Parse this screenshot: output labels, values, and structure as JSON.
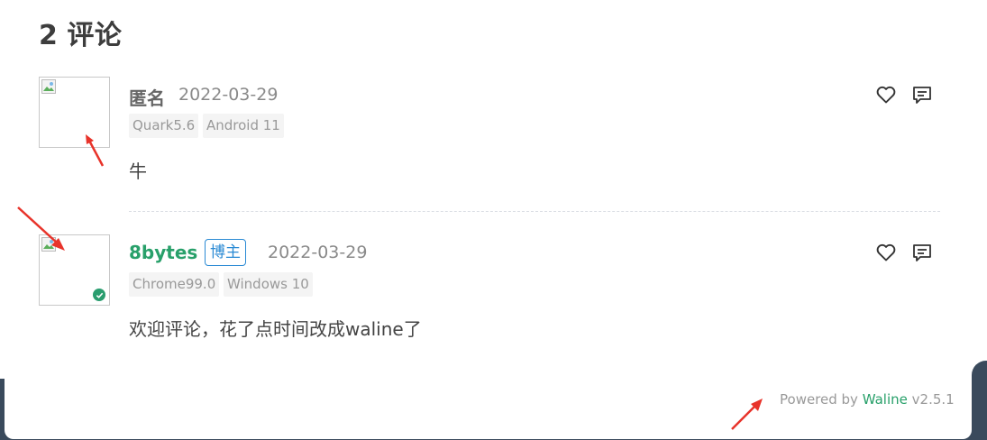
{
  "header": {
    "count": "2",
    "label": "评论"
  },
  "comments": [
    {
      "nick": "匿名",
      "date": "2022-03-29",
      "tags": [
        "Quark5.6",
        "Android 11"
      ],
      "content": "牛"
    },
    {
      "nick": "8bytes",
      "badge": "博主",
      "date": "2022-03-29",
      "tags": [
        "Chrome99.0",
        "Windows 10"
      ],
      "content": "欢迎评论，花了点时间改成waline了"
    }
  ],
  "footer": {
    "powered_by": "Powered by",
    "brand": "Waline",
    "version": "v2.5.1"
  },
  "colors": {
    "admin": "#28a06a",
    "badge": "#2a8ad4",
    "arrow": "#e8332a",
    "footer_bg": "#3a4a5c"
  },
  "icons": [
    "broken-image-icon",
    "verified-icon",
    "like-icon",
    "reply-icon",
    "annotation-arrow"
  ]
}
